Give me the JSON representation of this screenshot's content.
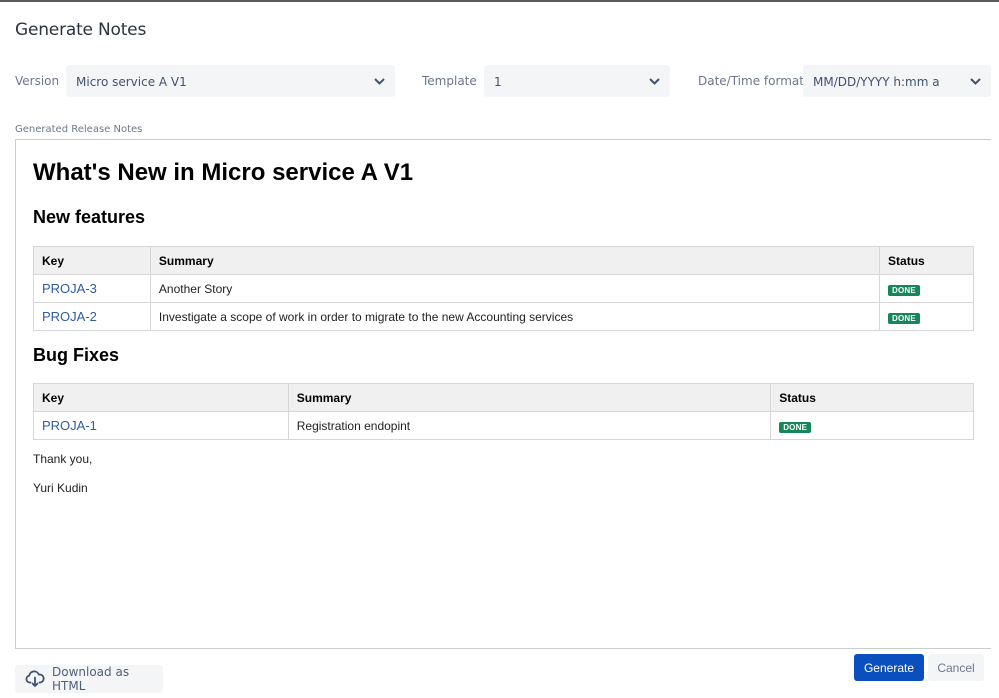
{
  "dialog": {
    "title": "Generate Notes"
  },
  "filters": {
    "version": {
      "label": "Version",
      "value": "Micro service A V1"
    },
    "template": {
      "label": "Template",
      "value": "1"
    },
    "datetime": {
      "label": "Date/Time format",
      "value": "MM/DD/YYYY h:mm a"
    }
  },
  "notes": {
    "section_label": "Generated Release Notes",
    "heading": "What's New in Micro service A V1",
    "sections": [
      {
        "title": "New features",
        "columns": [
          "Key",
          "Summary",
          "Status"
        ],
        "rows": [
          {
            "key": "PROJA-3",
            "summary": "Another Story",
            "status": "DONE"
          },
          {
            "key": "PROJA-2",
            "summary": "Investigate a scope of work in order to migrate to the new Accounting services",
            "status": "DONE"
          }
        ]
      },
      {
        "title": "Bug Fixes",
        "columns": [
          "Key",
          "Summary",
          "Status"
        ],
        "rows": [
          {
            "key": "PROJA-1",
            "summary": "Registration endopint",
            "status": "DONE"
          }
        ]
      }
    ],
    "closing": "Thank you,",
    "author": "Yuri Kudin"
  },
  "footer": {
    "download_label": "Download as HTML",
    "generate_label": "Generate",
    "cancel_label": "Cancel"
  },
  "colors": {
    "primary": "#0b4fbf",
    "done_badge": "#14865a",
    "link": "#2d5e9e"
  }
}
